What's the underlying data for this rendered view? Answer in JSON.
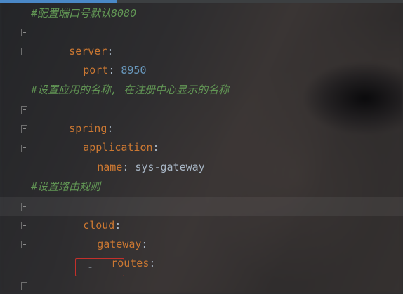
{
  "editor": {
    "comment_port": "#配置端口号默认8080",
    "server_key": "server",
    "port_key": "port",
    "port_value": "8950",
    "comment_name": "#设置应用的名称, 在注册中心显示的名称",
    "spring_key": "spring",
    "application_key": "application",
    "name_key": "name",
    "name_value": "sys-gateway",
    "comment_routes": "#设置路由规则",
    "cloud_key": "cloud",
    "gateway_key": "gateway",
    "routes_key": "routes",
    "dash": "-",
    "colon": ":"
  },
  "colors": {
    "key": "#cc7832",
    "comment": "#629755",
    "number": "#6897bb",
    "text": "#a9b7c6",
    "highlight_box": "#c4302b",
    "accent": "#4a88c7"
  }
}
